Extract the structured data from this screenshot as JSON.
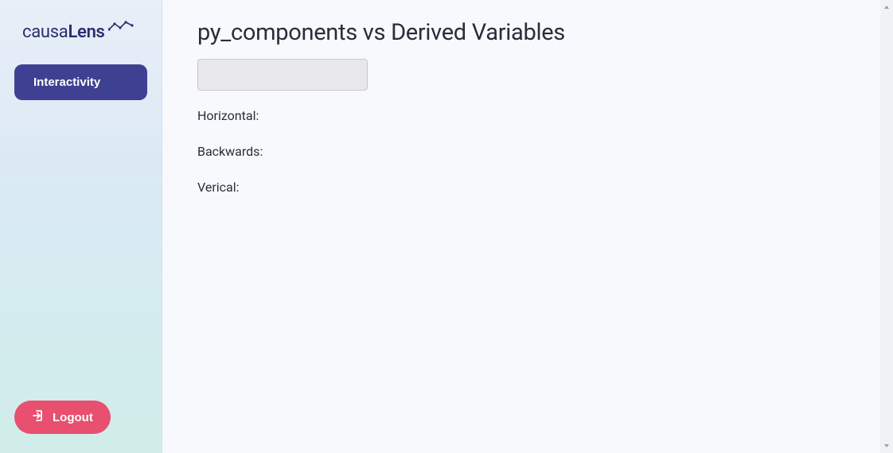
{
  "brand": {
    "name_part1": "causa",
    "name_part2": "Lens"
  },
  "sidebar": {
    "items": [
      {
        "label": "Interactivity"
      }
    ],
    "logout_label": "Logout"
  },
  "main": {
    "title": "py_components vs Derived Variables",
    "input_value": "",
    "labels": {
      "horizontal": "Horizontal:",
      "backwards": "Backwards:",
      "vertical": "Verical:"
    }
  }
}
